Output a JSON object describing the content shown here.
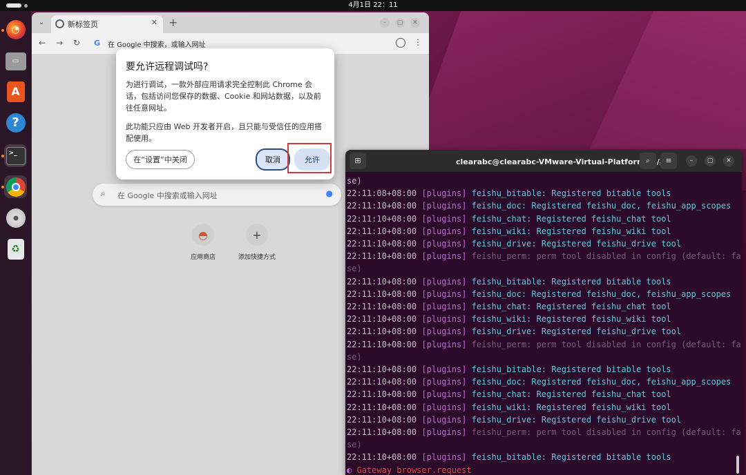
{
  "topbar": {
    "clock": "4月1日  22：11"
  },
  "dock": {
    "items": [
      {
        "name": "firefox-icon",
        "glyph": "🦊"
      },
      {
        "name": "files-icon",
        "glyph": "▭"
      },
      {
        "name": "app-center-icon",
        "glyph": "A"
      },
      {
        "name": "help-icon",
        "glyph": "?"
      },
      {
        "name": "terminal-icon",
        "glyph": ">_"
      },
      {
        "name": "chrome-icon",
        "glyph": "◉"
      },
      {
        "name": "disc-icon",
        "glyph": "◎"
      },
      {
        "name": "trash-icon",
        "glyph": "♻"
      }
    ]
  },
  "chrome": {
    "tab_title": "新标签页",
    "omnibox_text": "在 Google 中搜索，或输入网址",
    "search_placeholder": "在 Google 中搜索或输入网址",
    "shortcuts": [
      {
        "label": "应用商店",
        "glyph": "◓"
      },
      {
        "label": "添加快捷方式",
        "glyph": "+"
      }
    ]
  },
  "dialog": {
    "title": "要允许远程调试吗?",
    "body1": "为进行调试，一款外部应用请求完全控制此 Chrome 会话，包括访问您保存的数据、Cookie 和网站数据，以及前往任意网址。",
    "body2": "此功能只应由 Web 开发者开启，且只能与受信任的应用搭配使用。",
    "settings_btn": "在“设置”中关闭",
    "cancel_btn": "取消",
    "allow_btn": "允许"
  },
  "terminal": {
    "title": "clearabc@clearabc-VMware-Virtual-Platform: ~/桌面",
    "lines": [
      {
        "ts": "",
        "tag": "",
        "msg": "se)",
        "kind": "cont"
      },
      {
        "ts": "22:11:08+08:00",
        "tag": "[plugins]",
        "msg": "feishu_bitable: Registered bitable tools",
        "kind": "msg"
      },
      {
        "ts": "22:11:10+08:00",
        "tag": "[plugins]",
        "msg": "feishu_doc: Registered feishu_doc, feishu_app_scopes",
        "kind": "msg"
      },
      {
        "ts": "22:11:10+08:00",
        "tag": "[plugins]",
        "msg": "feishu_chat: Registered feishu_chat tool",
        "kind": "msg"
      },
      {
        "ts": "22:11:10+08:00",
        "tag": "[plugins]",
        "msg": "feishu_wiki: Registered feishu_wiki tool",
        "kind": "msg"
      },
      {
        "ts": "22:11:10+08:00",
        "tag": "[plugins]",
        "msg": "feishu_drive: Registered feishu_drive tool",
        "kind": "msg"
      },
      {
        "ts": "22:11:10+08:00",
        "tag": "[plugins]",
        "msg": "feishu_perm: perm tool disabled in config (default: fal",
        "kind": "dim"
      },
      {
        "ts": "",
        "tag": "",
        "msg": "se)",
        "kind": "dimcont"
      },
      {
        "ts": "22:11:10+08:00",
        "tag": "[plugins]",
        "msg": "feishu_bitable: Registered bitable tools",
        "kind": "msg"
      },
      {
        "ts": "22:11:10+08:00",
        "tag": "[plugins]",
        "msg": "feishu_doc: Registered feishu_doc, feishu_app_scopes",
        "kind": "msg"
      },
      {
        "ts": "22:11:10+08:00",
        "tag": "[plugins]",
        "msg": "feishu_chat: Registered feishu_chat tool",
        "kind": "msg"
      },
      {
        "ts": "22:11:10+08:00",
        "tag": "[plugins]",
        "msg": "feishu_wiki: Registered feishu_wiki tool",
        "kind": "msg"
      },
      {
        "ts": "22:11:10+08:00",
        "tag": "[plugins]",
        "msg": "feishu_drive: Registered feishu_drive tool",
        "kind": "msg"
      },
      {
        "ts": "22:11:10+08:00",
        "tag": "[plugins]",
        "msg": "feishu_perm: perm tool disabled in config (default: fal",
        "kind": "dim"
      },
      {
        "ts": "",
        "tag": "",
        "msg": "se)",
        "kind": "dimcont"
      },
      {
        "ts": "22:11:10+08:00",
        "tag": "[plugins]",
        "msg": "feishu_bitable: Registered bitable tools",
        "kind": "msg"
      },
      {
        "ts": "22:11:10+08:00",
        "tag": "[plugins]",
        "msg": "feishu_doc: Registered feishu_doc, feishu_app_scopes",
        "kind": "msg"
      },
      {
        "ts": "22:11:10+08:00",
        "tag": "[plugins]",
        "msg": "feishu_chat: Registered feishu_chat tool",
        "kind": "msg"
      },
      {
        "ts": "22:11:10+08:00",
        "tag": "[plugins]",
        "msg": "feishu_wiki: Registered feishu_wiki tool",
        "kind": "msg"
      },
      {
        "ts": "22:11:10+08:00",
        "tag": "[plugins]",
        "msg": "feishu_drive: Registered feishu_drive tool",
        "kind": "msg"
      },
      {
        "ts": "22:11:10+08:00",
        "tag": "[plugins]",
        "msg": "feishu_perm: perm tool disabled in config (default: fal",
        "kind": "dim"
      },
      {
        "ts": "",
        "tag": "",
        "msg": "se)",
        "kind": "dimcont"
      },
      {
        "ts": "22:11:10+08:00",
        "tag": "[plugins]",
        "msg": "feishu_bitable: Registered bitable tools",
        "kind": "msg"
      },
      {
        "ts": "",
        "tag": "◐",
        "msg": "Gateway browser.request",
        "kind": "gw"
      }
    ]
  }
}
